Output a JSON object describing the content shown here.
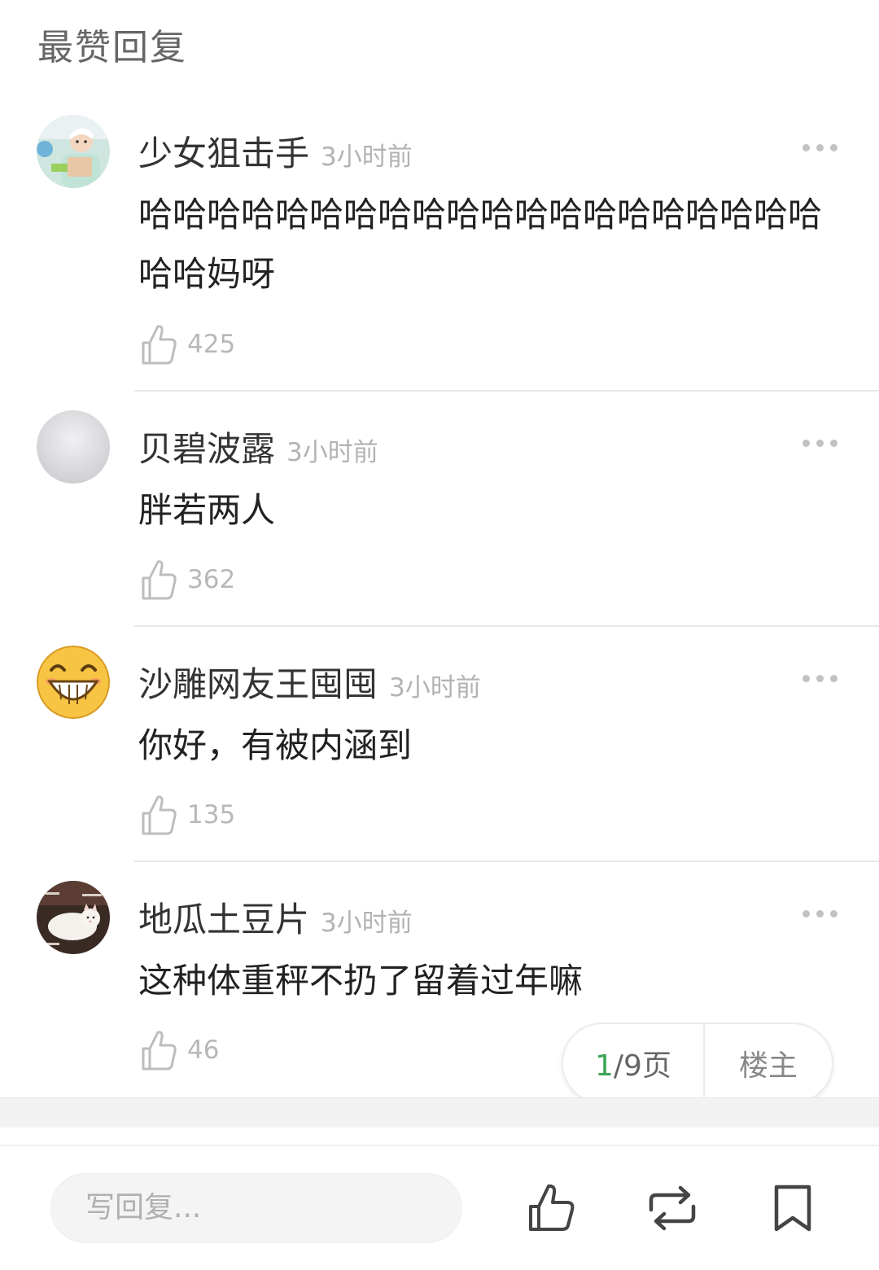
{
  "section_title": "最赞回复",
  "comments": [
    {
      "username": "少女狙击手",
      "time": "3小时前",
      "text": "哈哈哈哈哈哈哈哈哈哈哈哈哈哈哈哈哈哈哈哈哈哈妈呀",
      "likes": "425",
      "avatar": "girl-photo-avatar"
    },
    {
      "username": "贝碧波露",
      "time": "3小时前",
      "text": "胖若两人",
      "likes": "362",
      "avatar": "gray-blank-avatar"
    },
    {
      "username": "沙雕网友王囤囤",
      "time": "3小时前",
      "text": "你好，有被内涵到",
      "likes": "135",
      "avatar": "grinning-emoji-avatar"
    },
    {
      "username": "地瓜土豆片",
      "time": "3小时前",
      "text": "这种体重秤不扔了留着过年嘛",
      "likes": "46",
      "avatar": "cat-photo-avatar"
    }
  ],
  "pager": {
    "current": "1",
    "rest": "/9页",
    "owner_label": "楼主"
  },
  "bottom_bar": {
    "reply_placeholder": "写回复...",
    "icons": [
      "thumbs-up-icon",
      "repost-icon",
      "bookmark-icon"
    ]
  },
  "colors": {
    "accent_green": "#3aa655",
    "meta_gray": "#b3b3b3"
  }
}
